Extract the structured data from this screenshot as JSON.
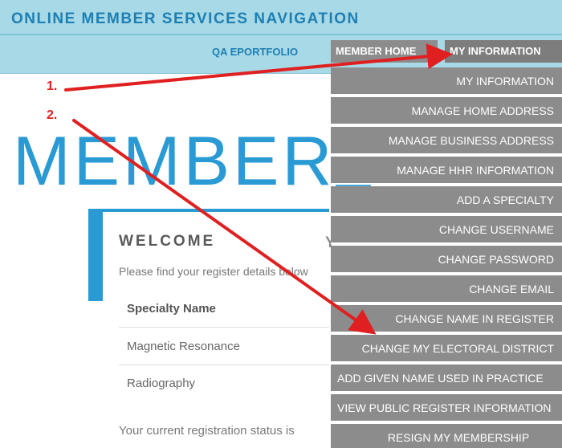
{
  "header": {
    "site_title": "ONLINE MEMBER SERVICES NAVIGATION",
    "nav": {
      "qa_eportfolio": "QA EPORTFOLIO",
      "member_home": "MEMBER HOME",
      "my_information": "MY INFORMATION"
    }
  },
  "main": {
    "heading": "MEMBER",
    "welcome": "WELCOME",
    "welcome_tail": "Y",
    "intro": "Please find your register details below",
    "table": {
      "header": "Specialty Name",
      "rows": [
        "Magnetic Resonance",
        "Radiography"
      ]
    },
    "status": "Your current registration status is"
  },
  "dropdown": {
    "items": [
      "MY INFORMATION",
      "MANAGE HOME ADDRESS",
      "MANAGE BUSINESS ADDRESS",
      "MANAGE HHR INFORMATION",
      "ADD A SPECIALTY",
      "CHANGE USERNAME",
      "CHANGE PASSWORD",
      "CHANGE EMAIL",
      "CHANGE NAME IN REGISTER",
      "CHANGE MY ELECTORAL DISTRICT",
      "ADD GIVEN NAME USED IN PRACTICE",
      "VIEW PUBLIC REGISTER INFORMATION",
      "RESIGN MY MEMBERSHIP"
    ]
  },
  "annotations": {
    "step1": "1.",
    "step2": "2.",
    "arrow_color": "#e02020"
  }
}
